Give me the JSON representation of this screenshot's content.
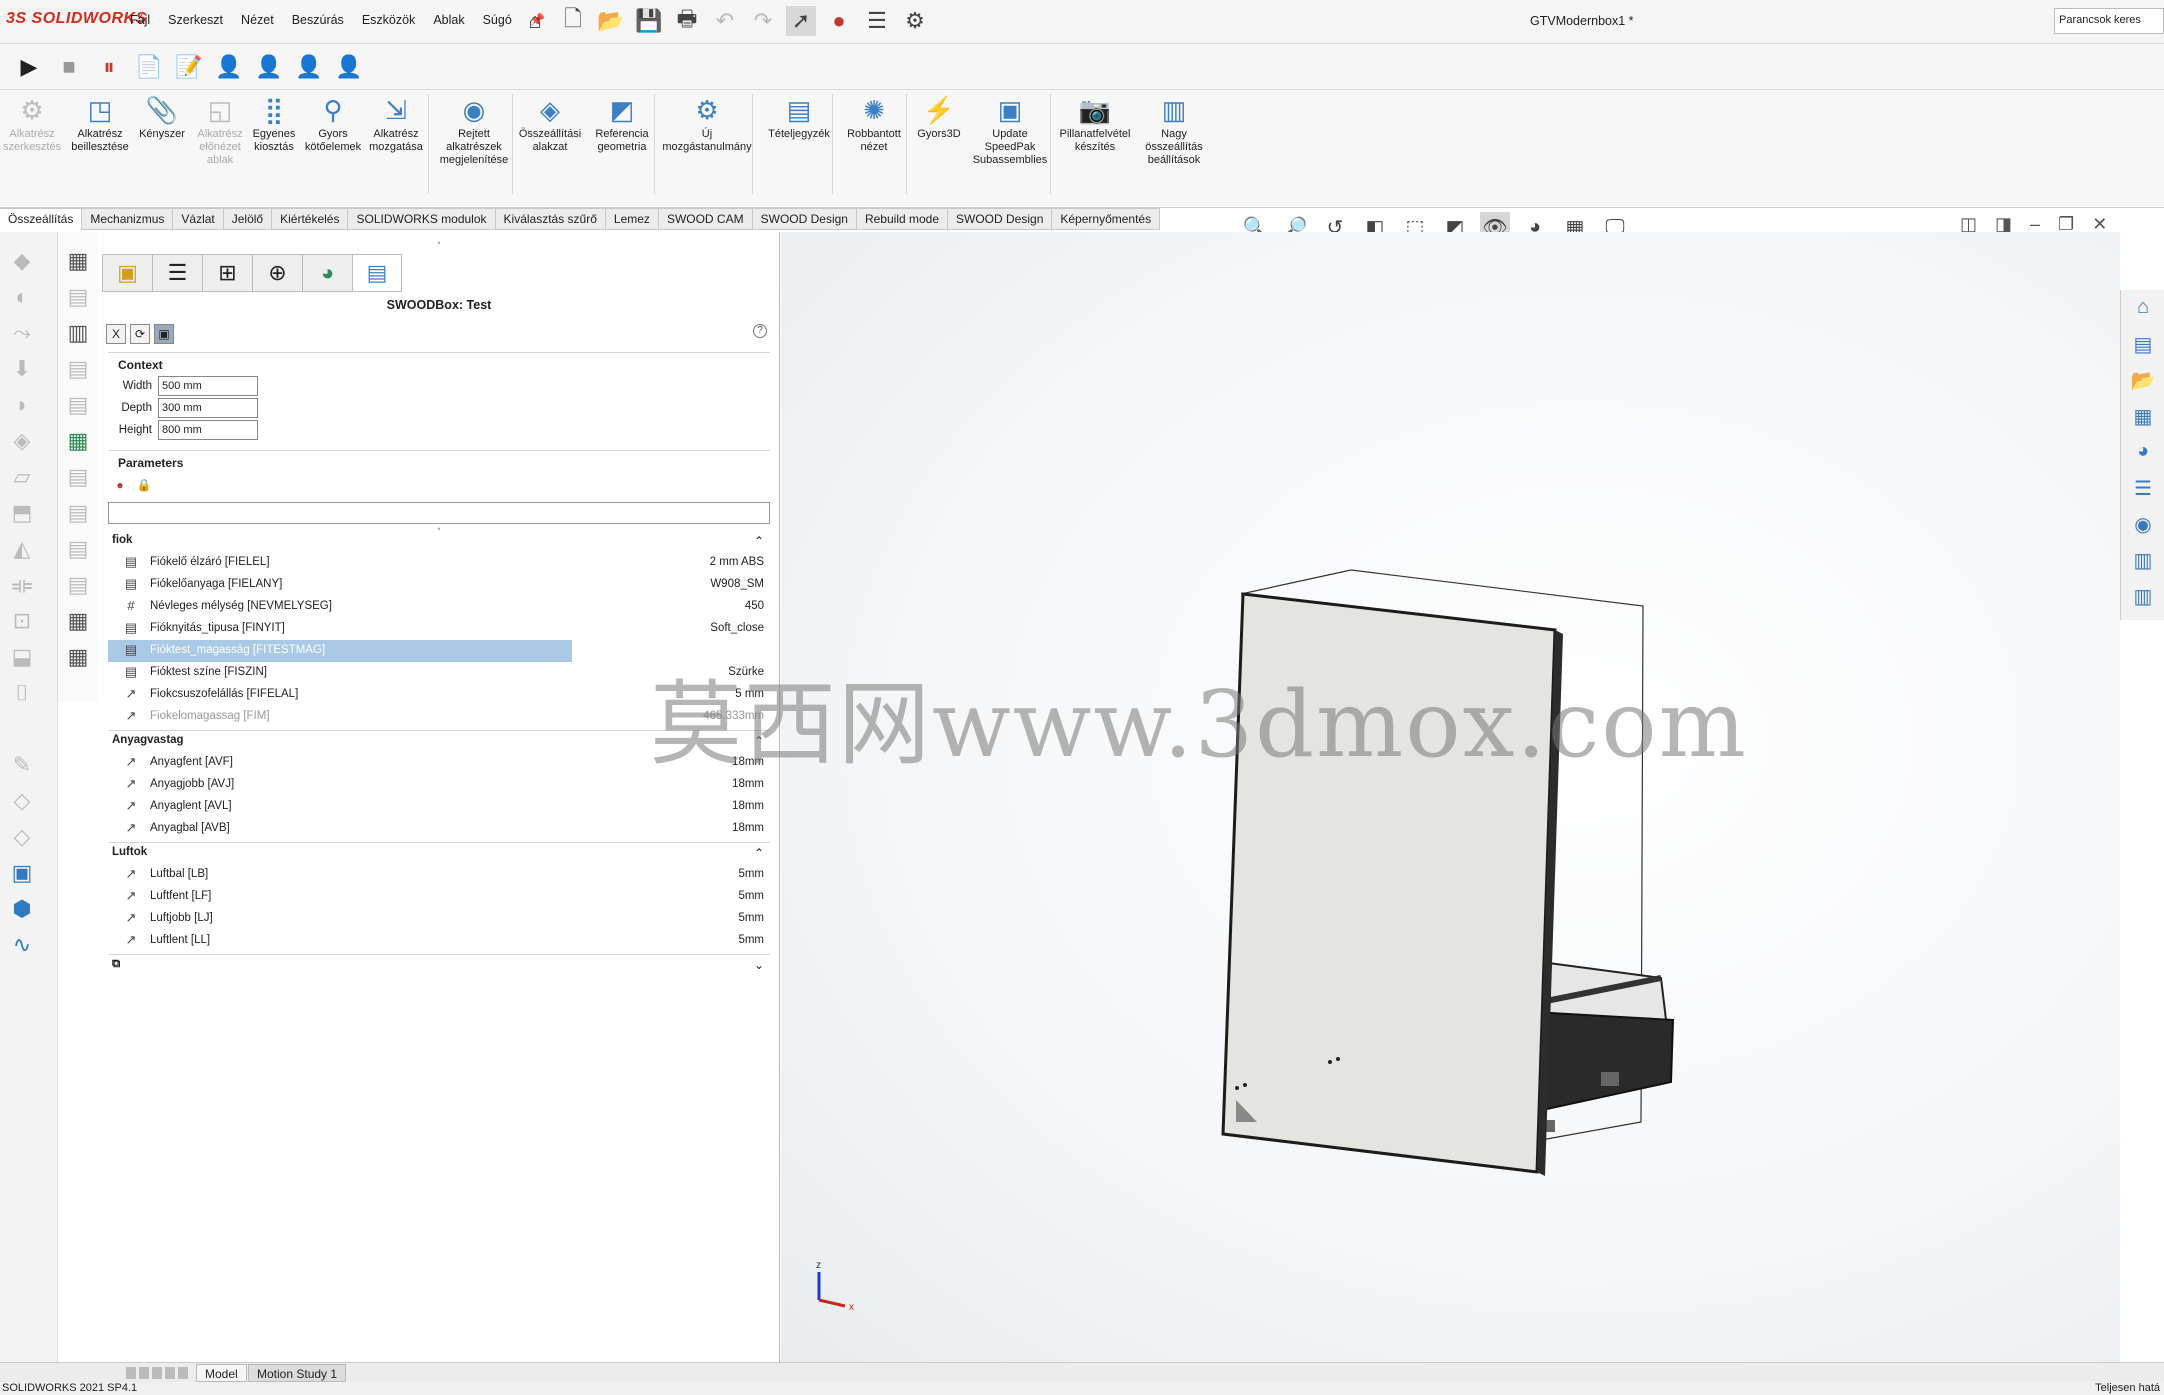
{
  "app": {
    "logo": "3S SOLIDWORKS",
    "doc_title": "GTVModernbox1 *",
    "search_placeholder": "Parancsok keres",
    "menu": [
      "Fájl",
      "Szerkeszt",
      "Nézet",
      "Beszúrás",
      "Eszközök",
      "Ablak",
      "Súgó"
    ]
  },
  "command_manager": [
    {
      "label": "Alkatrész szerkesztés",
      "icon": "edit-component-icon",
      "disabled": true
    },
    {
      "label": "Alkatrész beillesztése",
      "icon": "insert-component-icon",
      "disabled": false
    },
    {
      "label": "Kényszer",
      "icon": "mate-icon",
      "disabled": false
    },
    {
      "label": "Alkatrész előnézet ablak",
      "icon": "preview-window-icon",
      "disabled": true
    },
    {
      "label": "Egyenes kiosztás",
      "icon": "linear-pattern-icon",
      "disabled": false
    },
    {
      "label": "Gyors kötőelemek",
      "icon": "smart-fasteners-icon",
      "disabled": false
    },
    {
      "label": "Alkatrész mozgatása",
      "icon": "move-component-icon",
      "disabled": false
    },
    {
      "label": "Rejtett alkatrészek megjelenítése",
      "icon": "show-hidden-icon",
      "disabled": false
    },
    {
      "label": "Összeállítási alakzat",
      "icon": "assembly-feature-icon",
      "disabled": false
    },
    {
      "label": "Referencia geometria",
      "icon": "reference-geometry-icon",
      "disabled": false
    },
    {
      "label": "Új mozgástanulmány",
      "icon": "new-motion-study-icon",
      "disabled": false
    },
    {
      "label": "Tételjegyzék",
      "icon": "bom-icon",
      "disabled": false
    },
    {
      "label": "Robbantott nézet",
      "icon": "exploded-view-icon",
      "disabled": false
    },
    {
      "label": "Gyors3D",
      "icon": "instant3d-icon",
      "disabled": false
    },
    {
      "label": "Update SpeedPak Subassemblies",
      "icon": "speedpak-icon",
      "disabled": false
    },
    {
      "label": "Pillanatfelvétel készítés",
      "icon": "snapshot-icon",
      "disabled": false
    },
    {
      "label": "Nagy összeállítás beállítások",
      "icon": "large-assembly-icon",
      "disabled": false
    }
  ],
  "tabs": [
    "Összeállítás",
    "Mechanizmus",
    "Vázlat",
    "Jelölő",
    "Kiértékelés",
    "SOLIDWORKS modulok",
    "Kiválasztás szűrő",
    "Lemez",
    "SWOOD CAM",
    "SWOOD Design",
    "Rebuild mode",
    "SWOOD Design",
    "Képernyőmentés"
  ],
  "panel": {
    "title": "SWOODBox: Test",
    "context_label": "Context",
    "context": [
      {
        "label": "Width",
        "value": "500 mm"
      },
      {
        "label": "Depth",
        "value": "300 mm"
      },
      {
        "label": "Height",
        "value": "800 mm"
      }
    ],
    "parameters_label": "Parameters",
    "groups": [
      {
        "name": "fiok",
        "rows": [
          {
            "icon": "list-icon",
            "name": "Fiókelő élzáró [FIELEL]",
            "value": "2 mm ABS",
            "state": "normal"
          },
          {
            "icon": "list-icon",
            "name": "Fiókelőanyaga [FIELANY]",
            "value": "W908_SM",
            "state": "normal"
          },
          {
            "icon": "hash-icon",
            "name": "Névleges mélység [NEVMELYSEG]",
            "value": "450",
            "state": "normal"
          },
          {
            "icon": "list-icon",
            "name": "Fióknyitás_tipusa [FINYIT]",
            "value": "Soft_close",
            "state": "normal"
          },
          {
            "icon": "list-icon",
            "name": "Fióktest_magasság [FITESTMAG]",
            "value": "",
            "state": "selected"
          },
          {
            "icon": "list-icon",
            "name": "Fióktest színe [FISZIN]",
            "value": "Szürke",
            "state": "normal"
          },
          {
            "icon": "dimension-icon",
            "name": "Fiokcsuszofelállás [FIFELAL]",
            "value": "5 mm",
            "state": "normal"
          },
          {
            "icon": "dimension-icon",
            "name": "Fiokelomagassag [FIM]",
            "value": "465.333mm",
            "state": "disabled"
          }
        ]
      },
      {
        "name": "Anyagvastag",
        "rows": [
          {
            "icon": "dimension-icon",
            "name": "Anyagfent [AVF]",
            "value": "18mm",
            "state": "normal"
          },
          {
            "icon": "dimension-icon",
            "name": "Anyagjobb [AVJ]",
            "value": "18mm",
            "state": "normal"
          },
          {
            "icon": "dimension-icon",
            "name": "Anyaglent [AVL]",
            "value": "18mm",
            "state": "normal"
          },
          {
            "icon": "dimension-icon",
            "name": "Anyagbal [AVB]",
            "value": "18mm",
            "state": "normal"
          }
        ]
      },
      {
        "name": "Luftok",
        "rows": [
          {
            "icon": "dimension-icon",
            "name": "Luftbal [LB]",
            "value": "5mm",
            "state": "normal"
          },
          {
            "icon": "dimension-icon",
            "name": "Luftfent [LF]",
            "value": "5mm",
            "state": "normal"
          },
          {
            "icon": "dimension-icon",
            "name": "Luftjobb [LJ]",
            "value": "5mm",
            "state": "normal"
          },
          {
            "icon": "dimension-icon",
            "name": "Luftlent [LL]",
            "value": "5mm",
            "state": "normal"
          }
        ]
      }
    ]
  },
  "watermark": "莫西网www.3dmox.com",
  "triad": {
    "z": "z",
    "x": "x"
  },
  "bottom_tabs": [
    "Model",
    "Motion Study 1"
  ],
  "status": {
    "left": "SOLIDWORKS 2021 SP4.1",
    "right": "Teljesen hatá"
  },
  "colors": {
    "accent": "#3d7fc4",
    "selection": "#a9c9e6",
    "logo": "#d42a20"
  }
}
